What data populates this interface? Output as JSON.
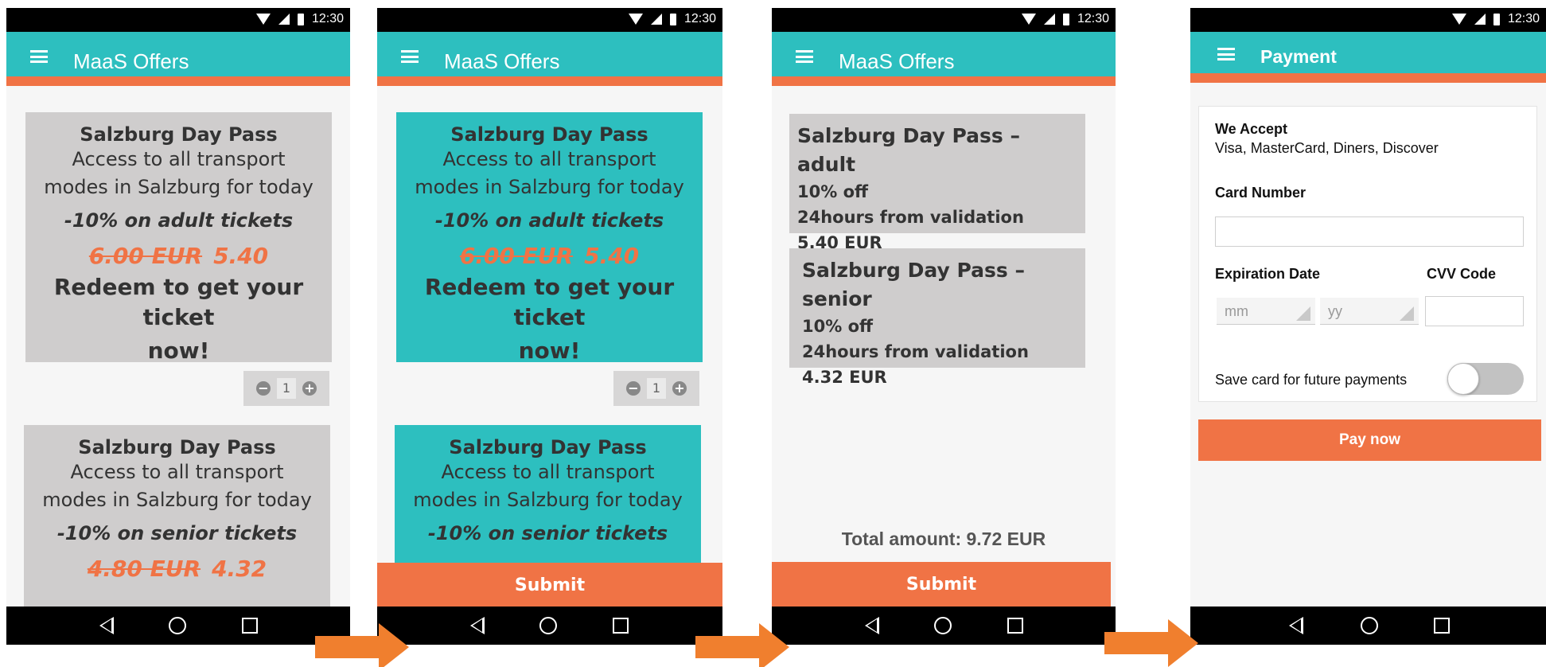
{
  "status_bar": {
    "time": "12:30"
  },
  "screens": {
    "offers": {
      "title": "MaaS Offers",
      "cards": [
        {
          "title": "Salzburg Day Pass",
          "description_line1": "Access to all transport",
          "description_line2": "modes in Salzburg for today",
          "discount": "-10% on adult tickets",
          "old_price": "6.00 EUR",
          "new_price": "5.40",
          "redeem_line1": "Redeem to get your ticket",
          "redeem_line2": "now!"
        },
        {
          "title": "Salzburg Day Pass",
          "description_line1": "Access to all transport",
          "description_line2": "modes in Salzburg for today",
          "discount": "-10% on senior tickets",
          "old_price": "4.80 EUR",
          "new_price": "4.32"
        }
      ],
      "stepper": {
        "minus": "−",
        "quantity": "1",
        "plus": "+"
      },
      "submit_label": "Submit"
    },
    "summary": {
      "title": "MaaS Offers",
      "items": [
        {
          "title": "Salzburg Day Pass – adult",
          "discount": "10% off",
          "validity": "24hours from validation",
          "price": "5.40 EUR"
        },
        {
          "title": "Salzburg Day Pass – senior",
          "discount": "10% off",
          "validity": "24hours from validation",
          "price": "4.32 EUR"
        }
      ],
      "total": "Total amount: 9.72 EUR",
      "submit_label": "Submit"
    },
    "payment": {
      "title": "Payment",
      "we_accept_label": "We Accept",
      "accepted_cards": "Visa, MasterCard, Diners, Discover",
      "card_number_label": "Card Number",
      "card_number_value": "",
      "expiration_label": "Expiration Date",
      "month_placeholder": "mm",
      "year_placeholder": "yy",
      "cvv_label": "CVV Code",
      "cvv_value": "",
      "save_card_label": "Save card for future payments",
      "save_card_enabled": false,
      "pay_label": "Pay now"
    }
  },
  "colors": {
    "teal": "#2dbfbf",
    "orange": "#f07345",
    "card_grey": "#cfcdcd",
    "arrow": "#f07f2e"
  },
  "icons": [
    "wifi-icon",
    "signal-icon",
    "battery-icon",
    "menu-icon",
    "back-icon",
    "home-icon",
    "recents-icon",
    "arrow-right-icon"
  ]
}
